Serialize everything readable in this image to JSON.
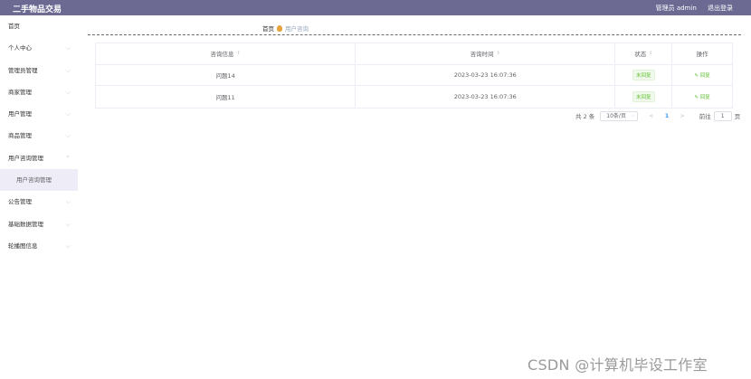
{
  "header": {
    "title": "二手物品交易",
    "user": "管理员 admin",
    "logout": "退出登录"
  },
  "sidebar": {
    "items": [
      {
        "label": "首页"
      },
      {
        "label": "个人中心"
      },
      {
        "label": "管理员管理"
      },
      {
        "label": "商家管理"
      },
      {
        "label": "用户管理"
      },
      {
        "label": "商品管理"
      },
      {
        "label": "用户咨询管理"
      },
      {
        "label": "用户咨询管理"
      },
      {
        "label": "公告管理"
      },
      {
        "label": "基础数据管理"
      },
      {
        "label": "轮播图信息"
      }
    ]
  },
  "breadcrumb": {
    "home": "首页",
    "current": "用户咨询"
  },
  "table": {
    "headers": [
      "咨询信息",
      "咨询时间",
      "状态",
      "操作"
    ],
    "rows": [
      {
        "info": "问题14",
        "time": "2023-03-23 16:07:36",
        "status": "未回复",
        "action": "回复"
      },
      {
        "info": "问题11",
        "time": "2023-03-23 16:07:36",
        "status": "未回复",
        "action": "回复"
      }
    ]
  },
  "pager": {
    "total": "共 2 条",
    "page_size": "10条/页",
    "prev": "<",
    "current": "1",
    "next": ">",
    "goto_label": "前往",
    "goto_value": "1",
    "goto_unit": "页"
  },
  "watermark": "CSDN @计算机毕设工作室"
}
